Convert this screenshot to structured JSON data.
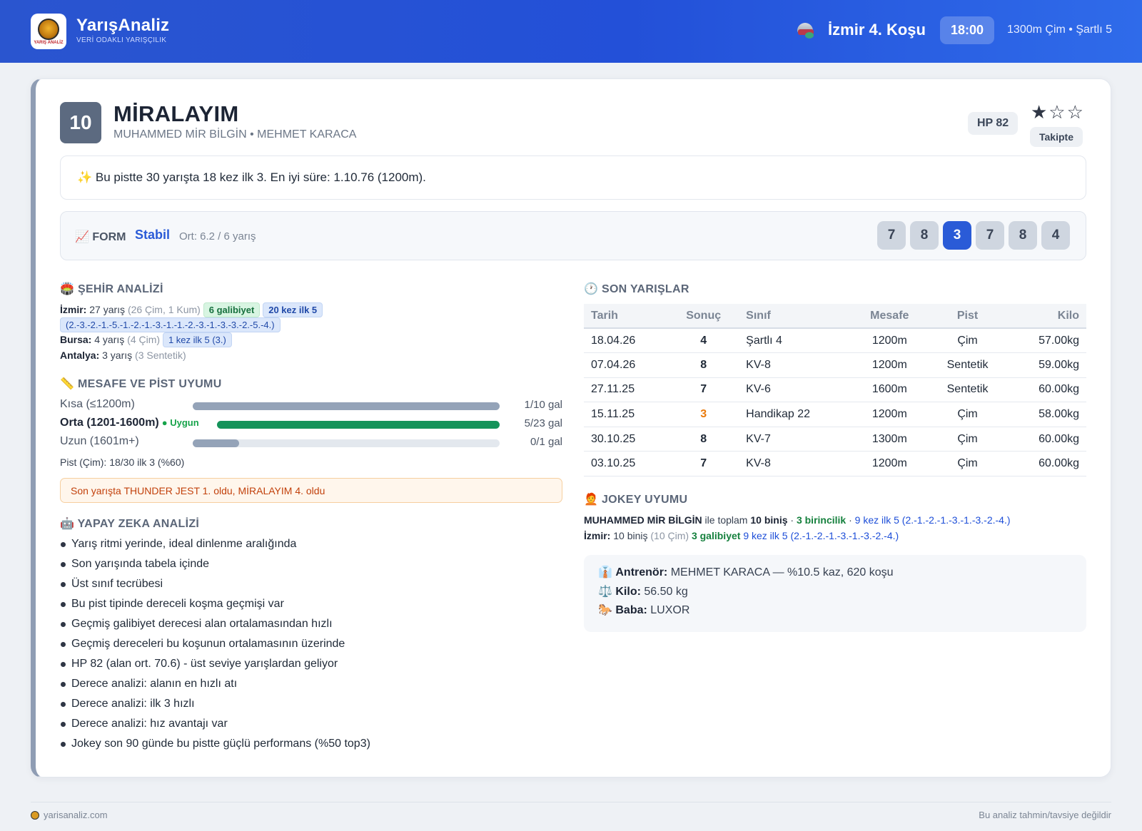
{
  "header": {
    "brand_title": "YarışAnaliz",
    "brand_subtitle": "VERİ ODAKLI YARIŞÇILIK",
    "logo_text": "YARIŞ ANALİZ",
    "race_name": "İzmir 4. Koşu",
    "race_time": "18:00",
    "race_info": "1300m Çim • Şartlı 5"
  },
  "horse": {
    "number": "10",
    "name": "MİRALAYIM",
    "connections": "MUHAMMED MİR BİLGİN • MEHMET KARACA",
    "hp_badge": "HP 82",
    "stars": "★☆☆",
    "follow_label": "Takipte"
  },
  "highlight_note": "✨ Bu pistte 30 yarışta 18 kez ilk 3. En iyi süre: 1.10.76 (1200m).",
  "form": {
    "label": "📈 FORM",
    "status": "Stabil",
    "average": "Ort: 6.2 / 6 yarış",
    "results": [
      "7",
      "8",
      "3",
      "7",
      "8",
      "4"
    ],
    "highlight_index": 2
  },
  "city_analysis": {
    "title": "🏟️ ŞEHİR ANALİZİ",
    "izmir": {
      "name": "İzmir:",
      "races": "27 yarış",
      "detail": "(26 Çim, 1 Kum)",
      "wins_tag": "6 galibiyet",
      "top5_tag": "20 kez ilk 5",
      "top5_detail": "(2.-3.-2.-1.-5.-1.-2.-1.-3.-1.-1.-2.-3.-1.-3.-3.-2.-5.-4.)"
    },
    "bursa": {
      "name": "Bursa:",
      "races": "4 yarış",
      "detail": "(4 Çim)",
      "top5_tag": "1 kez ilk 5 (3.)"
    },
    "antalya": {
      "name": "Antalya:",
      "races": "3 yarış",
      "detail": "(3 Sentetik)"
    }
  },
  "distance_fit": {
    "title": "📏 MESAFE VE PİST UYUMU",
    "rows": [
      {
        "name": "Kısa (≤1200m)",
        "value": "1/10 gal",
        "fill_pct": 100,
        "color": "#94a3b8",
        "bold": false,
        "badge": ""
      },
      {
        "name": "Orta (1201-1600m)",
        "value": "5/23 gal",
        "fill_pct": 100,
        "color": "#15935a",
        "bold": true,
        "badge": "Uygun"
      },
      {
        "name": "Uzun (1601m+)",
        "value": "0/1 gal",
        "fill_pct": 15,
        "color": "#94a3b8",
        "bold": false,
        "badge": ""
      }
    ],
    "pist_summary": "Pist (Çim): 18/30 ilk 3 (%60)"
  },
  "alert": "Son yarışta THUNDER JEST 1. oldu, MİRALAYIM 4. oldu",
  "ai_analysis": {
    "title": "🤖 YAPAY ZEKA ANALİZİ",
    "items": [
      "Yarış ritmi yerinde, ideal dinlenme aralığında",
      "Son yarışında tabela içinde",
      "Üst sınıf tecrübesi",
      "Bu pist tipinde dereceli koşma geçmişi var",
      "Geçmiş galibiyet derecesi alan ortalamasından hızlı",
      "Geçmiş dereceleri bu koşunun ortalamasının üzerinde",
      "HP 82 (alan ort. 70.6) - üst seviye yarışlardan geliyor",
      "Derece analizi: alanın en hızlı atı",
      "Derece analizi: ilk 3 hızlı",
      "Derece analizi: hız avantajı var",
      "Jokey son 90 günde bu pistte güçlü performans (%50 top3)"
    ]
  },
  "recent_races": {
    "title": "🕐 SON YARIŞLAR",
    "columns": [
      "Tarih",
      "Sonuç",
      "Sınıf",
      "Mesafe",
      "Pist",
      "Kilo"
    ],
    "rows": [
      {
        "date": "18.04.26",
        "result": "4",
        "class": "Şartlı 4",
        "distance": "1200m",
        "track": "Çim",
        "weight": "57.00kg"
      },
      {
        "date": "07.04.26",
        "result": "8",
        "class": "KV-8",
        "distance": "1200m",
        "track": "Sentetik",
        "weight": "59.00kg"
      },
      {
        "date": "27.11.25",
        "result": "7",
        "class": "KV-6",
        "distance": "1600m",
        "track": "Sentetik",
        "weight": "60.00kg"
      },
      {
        "date": "15.11.25",
        "result": "3",
        "class": "Handikap 22",
        "distance": "1200m",
        "track": "Çim",
        "weight": "58.00kg"
      },
      {
        "date": "30.10.25",
        "result": "8",
        "class": "KV-7",
        "distance": "1300m",
        "track": "Çim",
        "weight": "60.00kg"
      },
      {
        "date": "03.10.25",
        "result": "7",
        "class": "KV-8",
        "distance": "1200m",
        "track": "Çim",
        "weight": "60.00kg"
      }
    ]
  },
  "jockey_fit": {
    "title": "🧑‍🦰 JOKEY UYUMU",
    "jockey_name": "MUHAMMED MİR BİLGİN",
    "mid1": "ile toplam",
    "total_rides": "10 biniş",
    "wins": "3 birincilik",
    "top5": "9 kez ilk 5 (2.-1.-2.-1.-3.-1.-3.-2.-4.)",
    "city_name": "İzmir:",
    "city_rides": "10 biniş",
    "city_detail": "(10 Çim)",
    "city_wins": "3 galibiyet",
    "city_top5": "9 kez ilk 5 (2.-1.-2.-1.-3.-1.-3.-2.-4.)"
  },
  "details": {
    "trainer_label": "Antrenör:",
    "trainer_value": "MEHMET KARACA — %10.5 kaz, 620 koşu",
    "weight_label": "Kilo:",
    "weight_value": "56.50 kg",
    "sire_label": "Baba:",
    "sire_value": "LUXOR"
  },
  "footer": {
    "site": "yarisanaliz.com",
    "disclaimer": "Bu analiz tahmin/tavsiye değildir"
  }
}
